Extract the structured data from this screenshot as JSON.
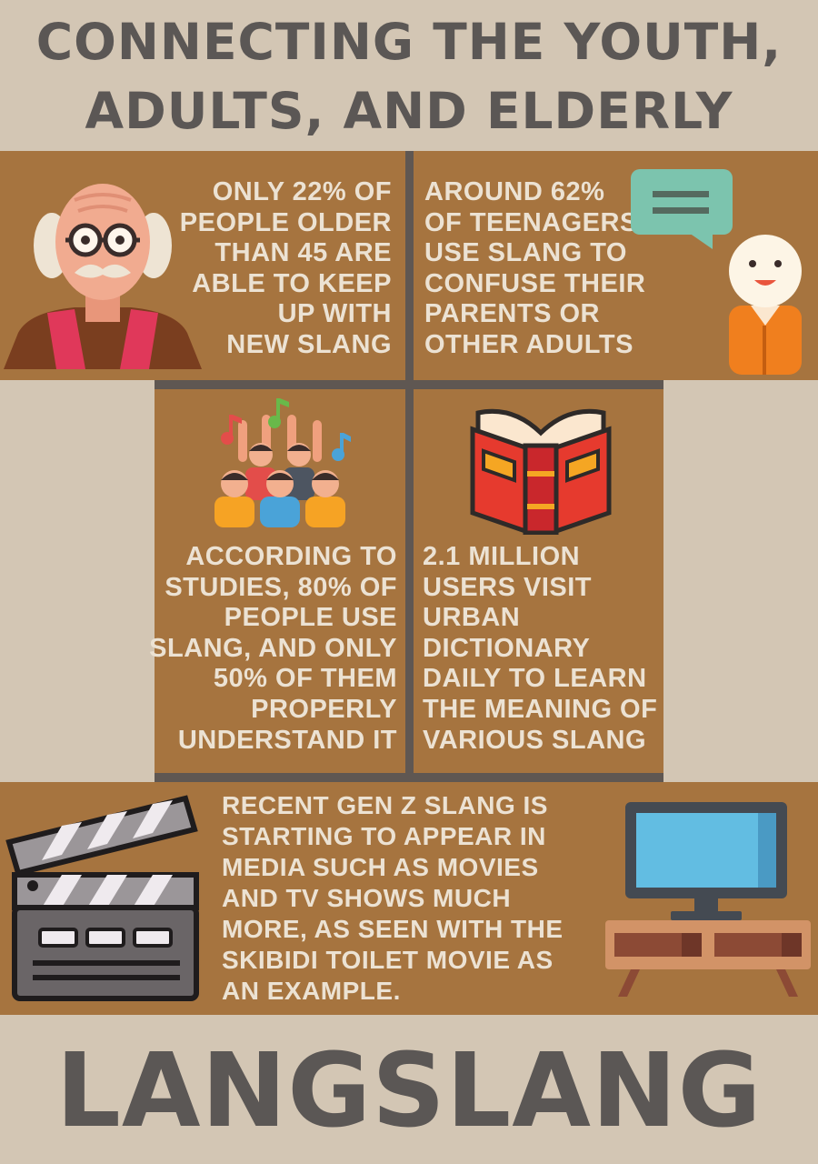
{
  "header": {
    "title_line1": "CONNECTING THE YOUTH,",
    "title_line2": "ADULTS, AND ELDERLY"
  },
  "stats": {
    "older_adults": [
      "ONLY 22% OF",
      "PEOPLE OLDER",
      "THAN 45 ARE",
      "ABLE TO KEEP",
      "UP WITH",
      "NEW SLANG"
    ],
    "teenagers": [
      "AROUND 62%",
      "OF TEENAGERS",
      "USE SLANG TO",
      "CONFUSE THEIR",
      "PARENTS OR",
      "OTHER ADULTS"
    ],
    "studies": [
      "ACCORDING TO",
      "STUDIES, 80% OF",
      "PEOPLE USE",
      "SLANG, AND ONLY",
      "50% OF THEM",
      "PROPERLY",
      "UNDERSTAND IT"
    ],
    "urban_dictionary": [
      "2.1 MILLION",
      "USERS VISIT",
      "URBAN",
      "DICTIONARY",
      "DAILY TO LEARN",
      "THE MEANING OF",
      "VARIOUS SLANG"
    ],
    "media": [
      "RECENT GEN Z SLANG IS",
      "STARTING TO APPEAR IN",
      "MEDIA SUCH AS MOVIES",
      "AND TV SHOWS MUCH",
      "MORE, AS SEEN WITH THE",
      "SKIBIDI TOILET MOVIE AS",
      "AN EXAMPLE."
    ]
  },
  "footer": {
    "brand": "LANGSLANG"
  },
  "icons": [
    "old-man-icon",
    "speech-bubble-icon",
    "young-person-icon",
    "crowd-icon",
    "music-note-icon",
    "open-book-icon",
    "clapperboard-icon",
    "television-icon"
  ],
  "colors": {
    "background": "#d3c6b4",
    "panel": "#a6743f",
    "divider": "#5f5752",
    "heading": "#5b5755",
    "panel_text": "#ece2d3"
  }
}
